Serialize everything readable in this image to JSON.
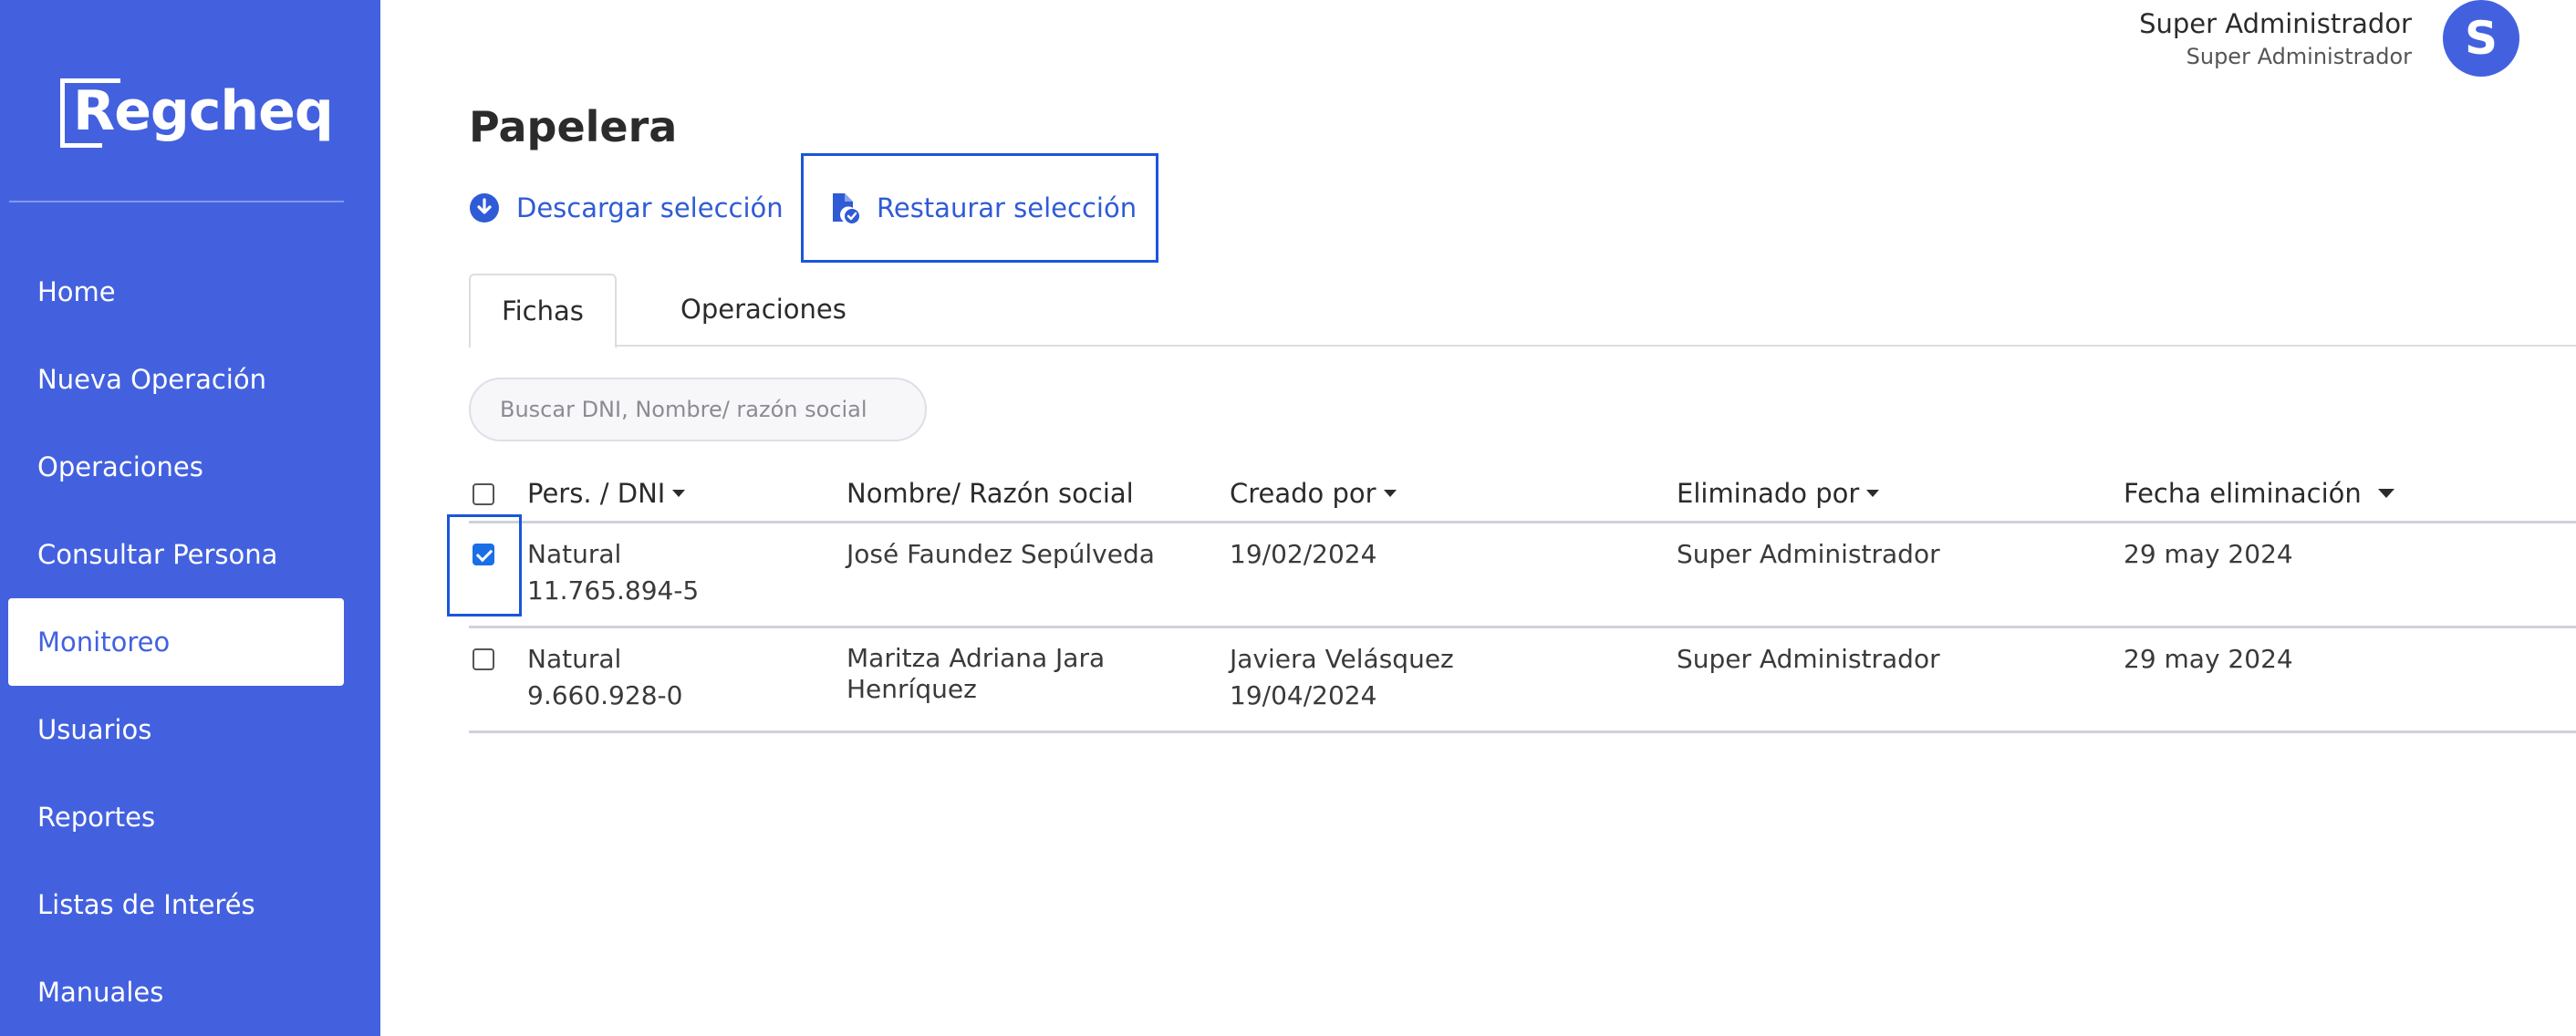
{
  "app": {
    "logo": "Regcheq"
  },
  "sidebar": {
    "items": [
      {
        "label": "Home"
      },
      {
        "label": "Nueva Operación"
      },
      {
        "label": "Operaciones"
      },
      {
        "label": "Consultar Persona"
      },
      {
        "label": "Monitoreo",
        "active": true
      },
      {
        "label": "Usuarios"
      },
      {
        "label": "Reportes"
      },
      {
        "label": "Listas de Interés"
      },
      {
        "label": "Manuales"
      }
    ]
  },
  "user": {
    "name": "Super Administrador",
    "role": "Super Administrador",
    "avatar_initial": "S",
    "avatar_color": "#4361df"
  },
  "page": {
    "title": "Papelera"
  },
  "actions": {
    "download_label": "Descargar selección",
    "download_icon": "download-circle-icon",
    "restore_label": "Restaurar selección",
    "restore_icon": "file-check-icon"
  },
  "tabs": [
    {
      "label": "Fichas",
      "active": true
    },
    {
      "label": "Operaciones",
      "active": false
    }
  ],
  "search": {
    "placeholder": "Buscar DNI, Nombre/ razón social",
    "value": ""
  },
  "table": {
    "headers": {
      "pers": "Pers. / DNI",
      "nombre": "Nombre/ Razón social",
      "creado": "Creado por",
      "eliminado": "Eliminado por",
      "fecha": "Fecha eliminación"
    },
    "rows": [
      {
        "checked": true,
        "tipo": "Natural",
        "dni": "11.765.894-5",
        "nombre": "José Faundez Sepúlveda",
        "creado_por": "",
        "creado_fecha": "19/02/2024",
        "eliminado_por": "Super Administrador",
        "fecha_eliminacion": "29 may 2024"
      },
      {
        "checked": false,
        "tipo": "Natural",
        "dni": "9.660.928-0",
        "nombre": "Maritza Adriana Jara Henríquez",
        "creado_por": "Javiera Velásquez",
        "creado_fecha": "19/04/2024",
        "eliminado_por": "Super Administrador",
        "fecha_eliminacion": "29 may 2024"
      }
    ]
  },
  "colors": {
    "sidebar": "#4361df",
    "accent": "#2f5bd6",
    "highlight": "#1a56db"
  }
}
